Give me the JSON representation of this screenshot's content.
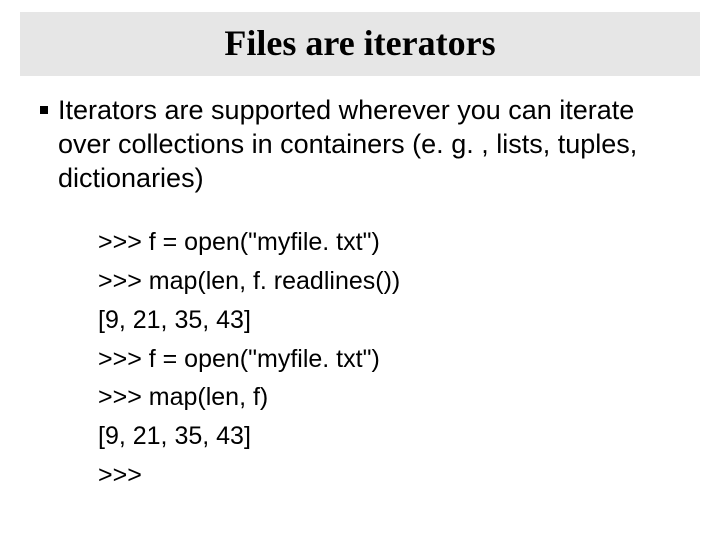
{
  "title": "Files are iterators",
  "bullet": "Iterators are supported wherever you can iterate over collections in containers (e. g. , lists, tuples, dictionaries)",
  "code": ">>> f = open(\"myfile. txt\")\n>>> map(len, f. readlines())\n[9, 21, 35, 43]\n>>> f = open(\"myfile. txt\")\n>>> map(len, f)\n[9, 21, 35, 43]\n>>>"
}
